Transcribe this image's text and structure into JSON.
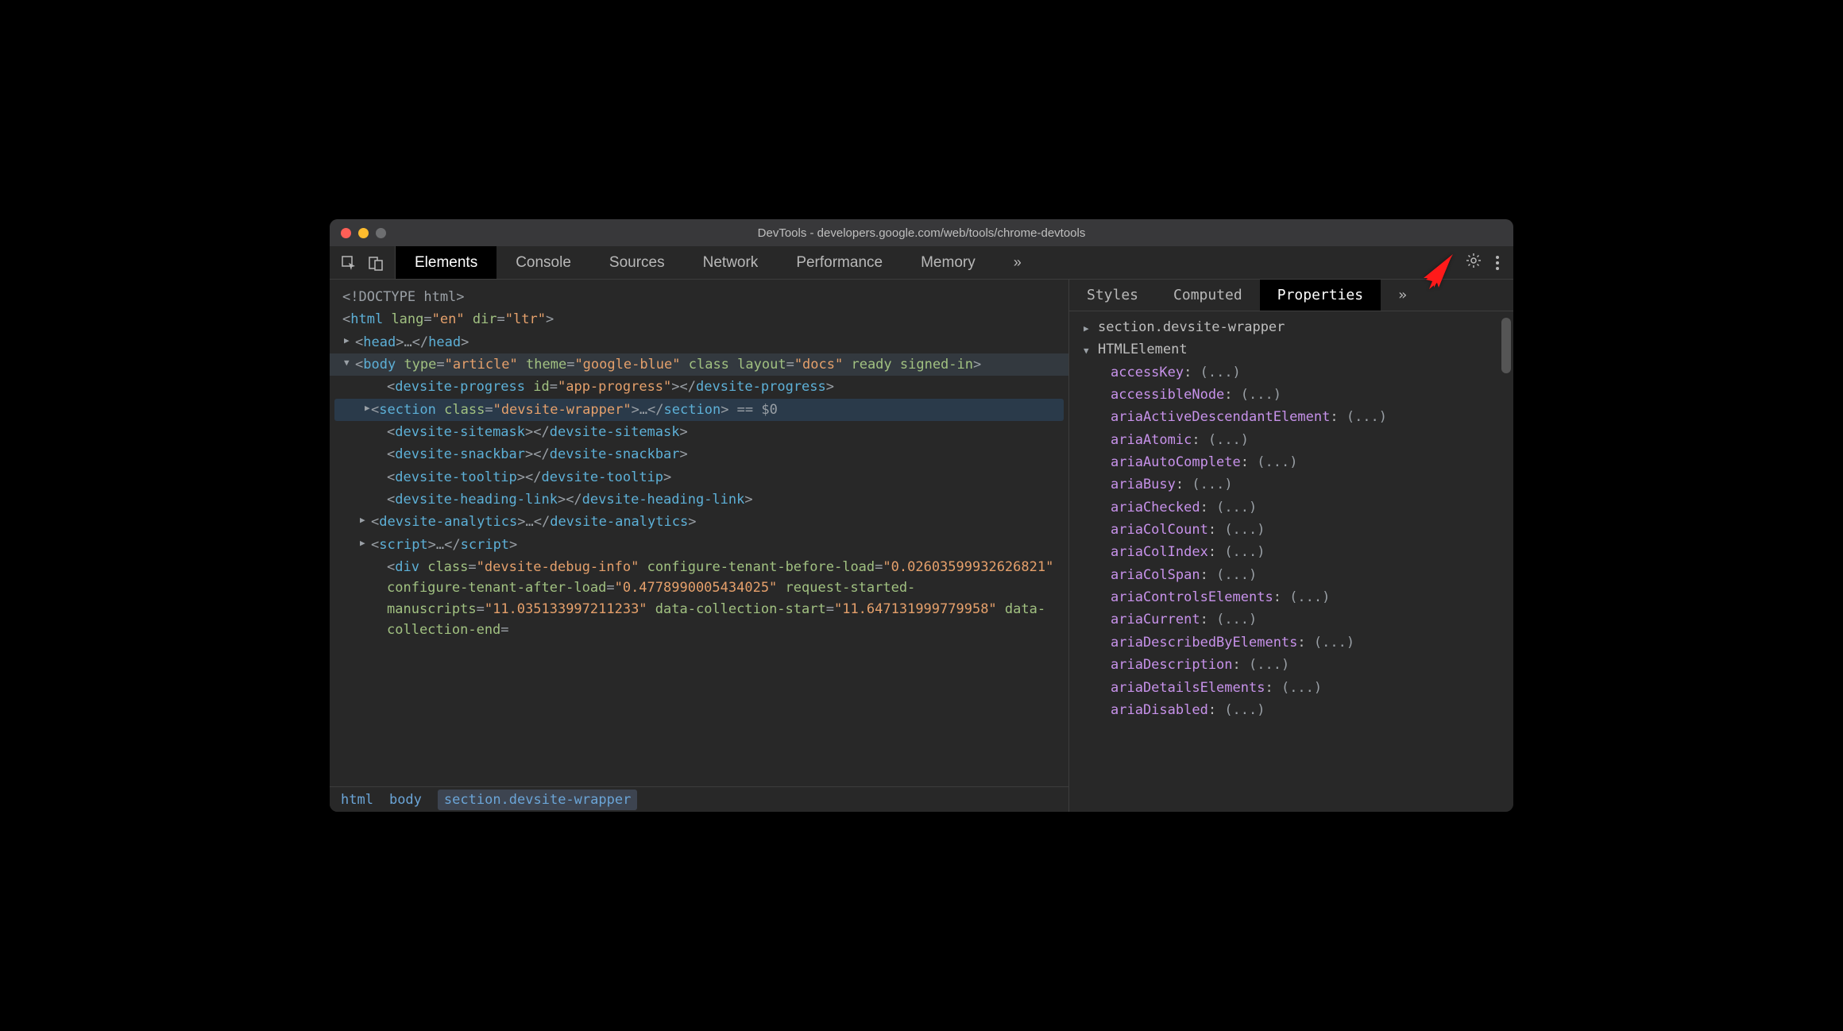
{
  "window": {
    "title": "DevTools - developers.google.com/web/tools/chrome-devtools"
  },
  "tabs": {
    "t0": "Elements",
    "t1": "Console",
    "t2": "Sources",
    "t3": "Network",
    "t4": "Performance",
    "t5": "Memory"
  },
  "dom": {
    "l0": "<!DOCTYPE html>",
    "l1_open": "<",
    "l1_tag": "html",
    "l1_a1": " lang",
    "l1_v1": "\"en\"",
    "l1_a2": " dir",
    "l1_v2": "\"ltr\"",
    "l1_close": ">",
    "l2_open": "<",
    "l2_tag": "head",
    "l2_mid": ">…</",
    "l2_tag2": "head",
    "l2_end": ">",
    "l3_open": "<",
    "l3_tag": "body",
    "l3_a1": " type",
    "l3_v1": "\"article\"",
    "l3_a2": " theme",
    "l3_v2": "\"google-blue\"",
    "l3_a3": " class layout",
    "l3_v3": "\"docs\"",
    "l3_a4": " ready signed-in",
    "l3_end": ">",
    "l4_open": "<",
    "l4_tag": "devsite-progress",
    "l4_a1": " id",
    "l4_v1": "\"app-progress\"",
    "l4_mid": "></",
    "l4_tag2": "devsite-progress",
    "l4_end": ">",
    "l5_dots": "⋯",
    "l5_open": "<",
    "l5_tag": "section",
    "l5_a1": " class",
    "l5_v1": "\"devsite-wrapper\"",
    "l5_mid": ">…</",
    "l5_tag2": "section",
    "l5_end": ">",
    "l5_eq": " == $0",
    "l6_open": "<",
    "l6_tag": "devsite-sitemask",
    "l6_mid": "></",
    "l6_tag2": "devsite-sitemask",
    "l6_end": ">",
    "l7_open": "<",
    "l7_tag": "devsite-snackbar",
    "l7_mid": "></",
    "l7_tag2": "devsite-snackbar",
    "l7_end": ">",
    "l8_open": "<",
    "l8_tag": "devsite-tooltip",
    "l8_mid": "></",
    "l8_tag2": "devsite-tooltip",
    "l8_end": ">",
    "l9_open": "<",
    "l9_tag": "devsite-heading-link",
    "l9_mid": "></",
    "l9_tag2": "devsite-heading-link",
    "l9_end": ">",
    "l10_open": "<",
    "l10_tag": "devsite-analytics",
    "l10_mid": ">…</",
    "l10_tag2": "devsite-analytics",
    "l10_end": ">",
    "l11_open": "<",
    "l11_tag": "script",
    "l11_mid": ">…</",
    "l11_tag2": "script",
    "l11_end": ">",
    "l12_open": "<",
    "l12_tag": "div",
    "l12_a1": " class",
    "l12_v1": "\"devsite-debug-info\"",
    "l12_a2": " configure-tenant-before-load",
    "l12_v2": "\"0.02603599932626821\"",
    "l12_a3": " configure-tenant-after-load",
    "l12_v3": "\"0.4778990005434025\"",
    "l12_a4": " request-started-manuscripts",
    "l12_v4": "\"11.035133997211233\"",
    "l12_a5": " data-collection-start",
    "l12_v5": "\"11.647131999779958\"",
    "l12_a6": " data-collection-end",
    "l12_eq": "="
  },
  "breadcrumbs": {
    "b0": "html",
    "b1": "body",
    "b2": "section.devsite-wrapper"
  },
  "sidetabs": {
    "s0": "Styles",
    "s1": "Computed",
    "s2": "Properties"
  },
  "props": {
    "h0": "section.devsite-wrapper",
    "h1": "HTMLElement",
    "p0": "accessKey",
    "p1": "accessibleNode",
    "p2": "ariaActiveDescendantElement",
    "p3": "ariaAtomic",
    "p4": "ariaAutoComplete",
    "p5": "ariaBusy",
    "p6": "ariaChecked",
    "p7": "ariaColCount",
    "p8": "ariaColIndex",
    "p9": "ariaColSpan",
    "p10": "ariaControlsElements",
    "p11": "ariaCurrent",
    "p12": "ariaDescribedByElements",
    "p13": "ariaDescription",
    "p14": "ariaDetailsElements",
    "p15": "ariaDisabled",
    "ellipsis": "(...)"
  }
}
